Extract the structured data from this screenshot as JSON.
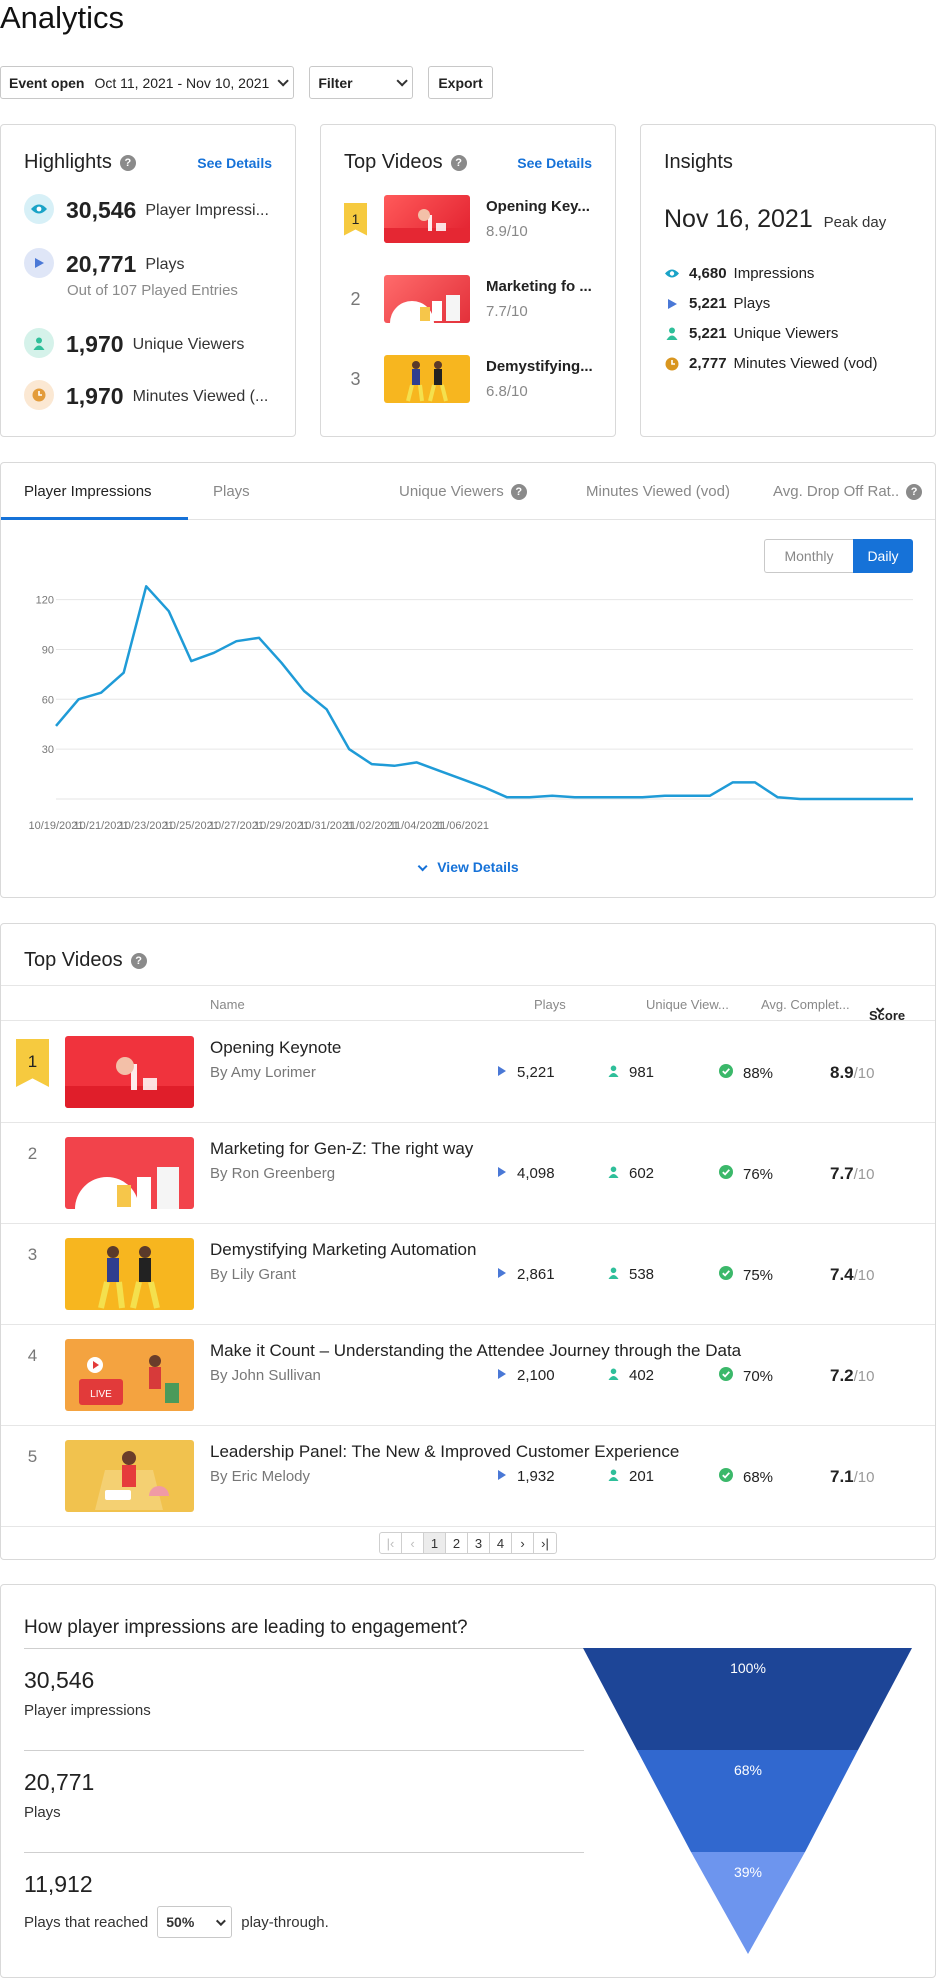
{
  "page": {
    "title": "Analytics"
  },
  "toolbar": {
    "event_label": "Event open",
    "date_range": "Oct 11, 2021 - Nov 10, 2021",
    "filter_label": "Filter",
    "export_label": "Export"
  },
  "highlights": {
    "title": "Highlights",
    "see_details": "See Details",
    "items": [
      {
        "value": "30,546",
        "label": "Player Impressi...",
        "icon": "eye-icon",
        "color": "#1aa3c7"
      },
      {
        "value": "20,771",
        "label": "Plays",
        "sub": "Out of 107 Played Entries",
        "icon": "play-icon",
        "color": "#4a78d6"
      },
      {
        "value": "1,970",
        "label": "Unique Viewers",
        "icon": "user-icon",
        "color": "#2fbf9a"
      },
      {
        "value": "1,970",
        "label": "Minutes Viewed (...",
        "icon": "clock-icon",
        "color": "#e39c3b"
      }
    ]
  },
  "top_videos_card": {
    "title": "Top Videos",
    "see_details": "See Details",
    "items": [
      {
        "rank": "1",
        "name": "Opening Key...",
        "score": "8.9/10"
      },
      {
        "rank": "2",
        "name": "Marketing fo ...",
        "score": "7.7/10"
      },
      {
        "rank": "3",
        "name": "Demystifying...",
        "score": "6.8/10"
      }
    ]
  },
  "insights": {
    "title": "Insights",
    "date": "Nov 16, 2021",
    "peak_label": "Peak day",
    "items": [
      {
        "value": "4,680",
        "label": "Impressions",
        "icon": "eye-icon",
        "color": "#1aa3c7"
      },
      {
        "value": "5,221",
        "label": "Plays",
        "icon": "play-icon",
        "color": "#4a78d6"
      },
      {
        "value": "5,221",
        "label": "Unique Viewers",
        "icon": "user-icon",
        "color": "#2fbf9a"
      },
      {
        "value": "2,777",
        "label": "Minutes Viewed (vod)",
        "icon": "clock-icon",
        "color": "#d9961f"
      }
    ]
  },
  "chart_panel": {
    "tabs": [
      "Player Impressions",
      "Plays",
      "Unique Viewers",
      "Minutes Viewed (vod)",
      "Avg. Drop Off Rat.."
    ],
    "period_monthly": "Monthly",
    "period_daily": "Daily",
    "view_details": "View Details",
    "line_color": "#1f9bd7"
  },
  "chart_data": {
    "type": "line",
    "title": "",
    "xlabel": "",
    "ylabel": "",
    "ylim": [
      0,
      130
    ],
    "yticks": [
      30,
      60,
      90,
      120
    ],
    "x_tick_labels": [
      "10/19/2021",
      "10/21/2021",
      "10/23/2021",
      "10/25/2021",
      "10/27/2021",
      "10/29/2021",
      "10/31/2021",
      "11/02/2021",
      "11/04/2021",
      "11/06/2021"
    ],
    "grid": true,
    "series": [
      {
        "values": [
          44,
          60,
          64,
          76,
          128,
          113,
          83,
          88,
          95,
          97,
          82,
          65,
          54,
          30,
          21,
          20,
          22,
          17,
          12,
          7,
          1,
          1,
          2,
          1,
          1,
          1,
          1,
          2,
          2,
          2,
          10,
          10,
          1,
          0,
          0,
          0,
          0,
          0,
          0
        ]
      }
    ]
  },
  "top_videos_table": {
    "title": "Top Videos",
    "columns": {
      "name": "Name",
      "plays": "Plays",
      "viewers": "Unique View...",
      "completion": "Avg. Complet...",
      "score": "Score"
    },
    "rows": [
      {
        "rank": "1",
        "name": "Opening Keynote",
        "by": "By Amy Lorimer",
        "plays": "5,221",
        "viewers": "981",
        "completion": "88%",
        "score": "8.9",
        "score_max": "/10"
      },
      {
        "rank": "2",
        "name": "Marketing for Gen-Z: The right way",
        "by": "By Ron Greenberg",
        "plays": "4,098",
        "viewers": "602",
        "completion": "76%",
        "score": "7.7",
        "score_max": "/10"
      },
      {
        "rank": "3",
        "name": "Demystifying Marketing Automation",
        "by": "By Lily Grant",
        "plays": "2,861",
        "viewers": "538",
        "completion": "75%",
        "score": "7.4",
        "score_max": "/10"
      },
      {
        "rank": "4",
        "name": "Make it Count – Understanding the Attendee Journey through the Data",
        "by": "By John Sullivan",
        "plays": "2,100",
        "viewers": "402",
        "completion": "70%",
        "score": "7.2",
        "score_max": "/10"
      },
      {
        "rank": "5",
        "name": "Leadership Panel: The New & Improved Customer Experience",
        "by": "By Eric Melody",
        "plays": "1,932",
        "viewers": "201",
        "completion": "68%",
        "score": "7.1",
        "score_max": "/10"
      }
    ],
    "pager": {
      "pages": [
        "1",
        "2",
        "3",
        "4"
      ],
      "current": "1"
    }
  },
  "funnel": {
    "title": "How player impressions are leading to engagement?",
    "rows": [
      {
        "value": "30,546",
        "label": "Player impressions",
        "pct": "100%",
        "color": "#1d4597"
      },
      {
        "value": "20,771",
        "label": "Plays",
        "pct": "68%",
        "color": "#3168cf"
      },
      {
        "value": "11,912",
        "label_before": "Plays that reached",
        "select": "50%",
        "label_after": "play-through.",
        "pct": "39%",
        "color": "#6d95ee"
      }
    ]
  }
}
